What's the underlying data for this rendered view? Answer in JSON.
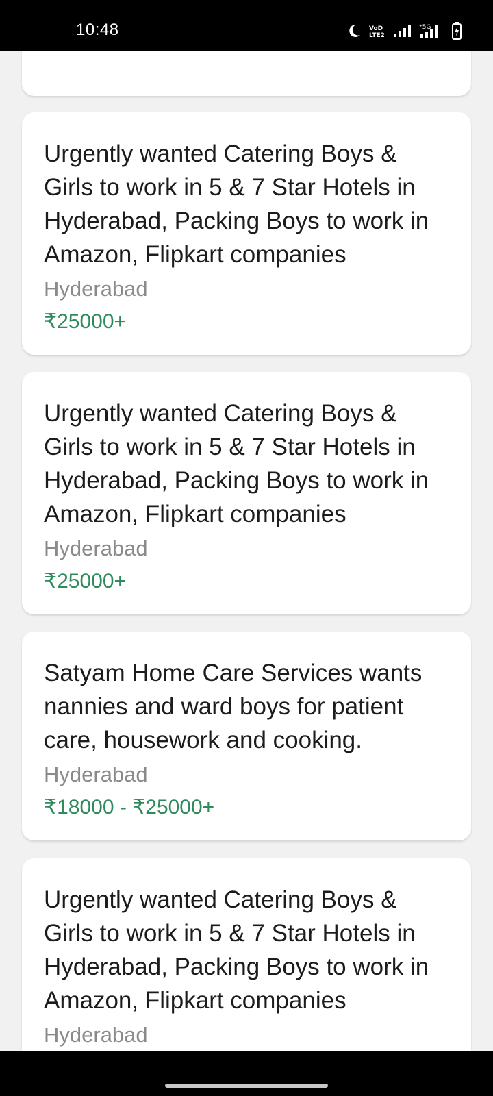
{
  "status_bar": {
    "time": "10:48",
    "icons": [
      "moon-icon",
      "volte-icon",
      "signal-icon",
      "5g-signal-icon",
      "battery-charging-icon"
    ],
    "network_label": "5G"
  },
  "listings": [
    {
      "title": "",
      "location": "",
      "salary": ""
    },
    {
      "title": "Urgently wanted Catering Boys & Girls to work in 5 & 7 Star Hotels in Hyderabad, Packing Boys to work in Amazon, Flipkart companies",
      "location": "Hyderabad",
      "salary": "₹25000+"
    },
    {
      "title": "Urgently wanted Catering Boys & Girls to work in 5 & 7 Star Hotels in Hyderabad, Packing Boys to work in Amazon, Flipkart companies",
      "location": "Hyderabad",
      "salary": "₹25000+"
    },
    {
      "title": "Satyam Home Care Services wants nannies and ward boys for patient care, housework and cooking.",
      "location": "Hyderabad",
      "salary": "₹18000 - ₹25000+"
    },
    {
      "title": "Urgently wanted Catering Boys & Girls to work in 5 & 7 Star Hotels in Hyderabad, Packing Boys to work in Amazon, Flipkart companies",
      "location": "Hyderabad",
      "salary": ""
    }
  ],
  "colors": {
    "background": "#f1f1f1",
    "card": "#ffffff",
    "title_text": "#1c1c1c",
    "location_text": "#8a8a8a",
    "salary_text": "#2f8a5c"
  }
}
